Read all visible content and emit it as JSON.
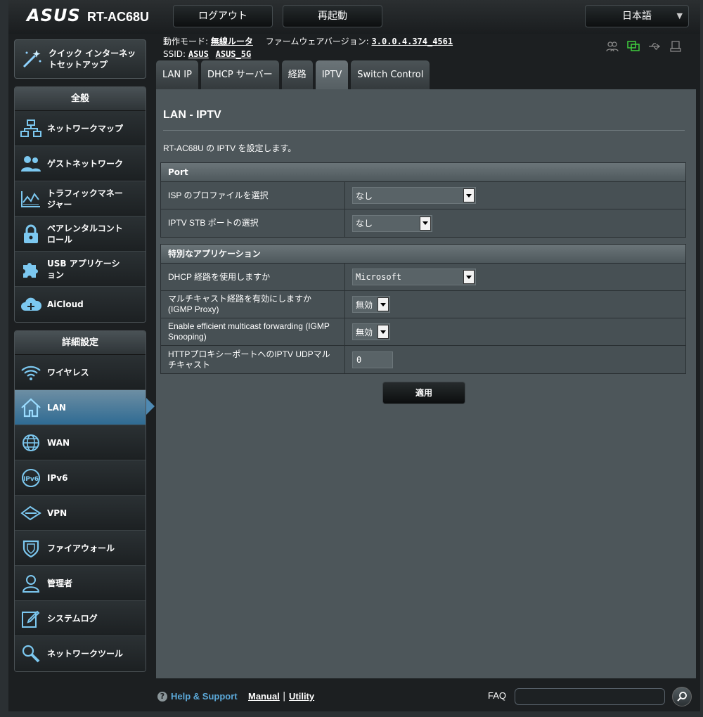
{
  "header": {
    "logo": "ASUS",
    "model": "RT-AC68U",
    "logout_label": "ログアウト",
    "reboot_label": "再起動",
    "language": "日本語"
  },
  "status": {
    "mode_label": "動作モード:",
    "mode_value": "無線ルータ",
    "firmware_label": "ファームウェアバージョン:",
    "firmware_value": "3.0.0.4.374_4561",
    "ssid_label": "SSID:",
    "ssid_1": "ASUS",
    "ssid_2": "ASUS_5G"
  },
  "sidebar": {
    "quick_setup": "クイック インターネットセットアップ",
    "general_title": "全般",
    "general": [
      {
        "label": "ネットワークマップ",
        "icon": "network-map-icon"
      },
      {
        "label": "ゲストネットワーク",
        "icon": "guest-network-icon"
      },
      {
        "label": "トラフィックマネージャー",
        "icon": "traffic-manager-icon"
      },
      {
        "label": "ペアレンタルコントロール",
        "icon": "parental-control-icon"
      },
      {
        "label": "USB アプリケーション",
        "icon": "usb-app-icon"
      },
      {
        "label": "AiCloud",
        "icon": "aicloud-icon"
      }
    ],
    "advanced_title": "詳細設定",
    "advanced": [
      {
        "label": "ワイヤレス",
        "icon": "wireless-icon"
      },
      {
        "label": "LAN",
        "icon": "lan-icon"
      },
      {
        "label": "WAN",
        "icon": "wan-icon"
      },
      {
        "label": "IPv6",
        "icon": "ipv6-icon"
      },
      {
        "label": "VPN",
        "icon": "vpn-icon"
      },
      {
        "label": "ファイアウォール",
        "icon": "firewall-icon"
      },
      {
        "label": "管理者",
        "icon": "admin-icon"
      },
      {
        "label": "システムログ",
        "icon": "system-log-icon"
      },
      {
        "label": "ネットワークツール",
        "icon": "network-tools-icon"
      }
    ]
  },
  "tabs": [
    "LAN IP",
    "DHCP サーバー",
    "経路",
    "IPTV",
    "Switch Control"
  ],
  "main": {
    "title": "LAN - IPTV",
    "description": "RT-AC68U の IPTV を設定します。",
    "port_section": "Port",
    "isp_profile_label": "ISP のプロファイルを選択",
    "isp_profile_value": "なし",
    "stb_port_label": "IPTV STB ポートの選択",
    "stb_port_value": "なし",
    "special_section": "特別なアプリケーション",
    "dhcp_route_label": "DHCP 経路を使用しますか",
    "dhcp_route_value": "Microsoft",
    "multicast_label": "マルチキャスト経路を有効にしますか (IGMP Proxy)",
    "multicast_value": "無効",
    "efficient_label": "Enable efficient multicast forwarding (IGMP Snooping)",
    "efficient_value": "無効",
    "udp_proxy_label": "HTTPプロキシーポートへのIPTV UDPマルチキャスト",
    "udp_proxy_value": "0",
    "apply_label": "適用"
  },
  "footer": {
    "help": "Help & Support",
    "manual": "Manual",
    "separator": "|",
    "utility": "Utility",
    "faq": "FAQ"
  }
}
